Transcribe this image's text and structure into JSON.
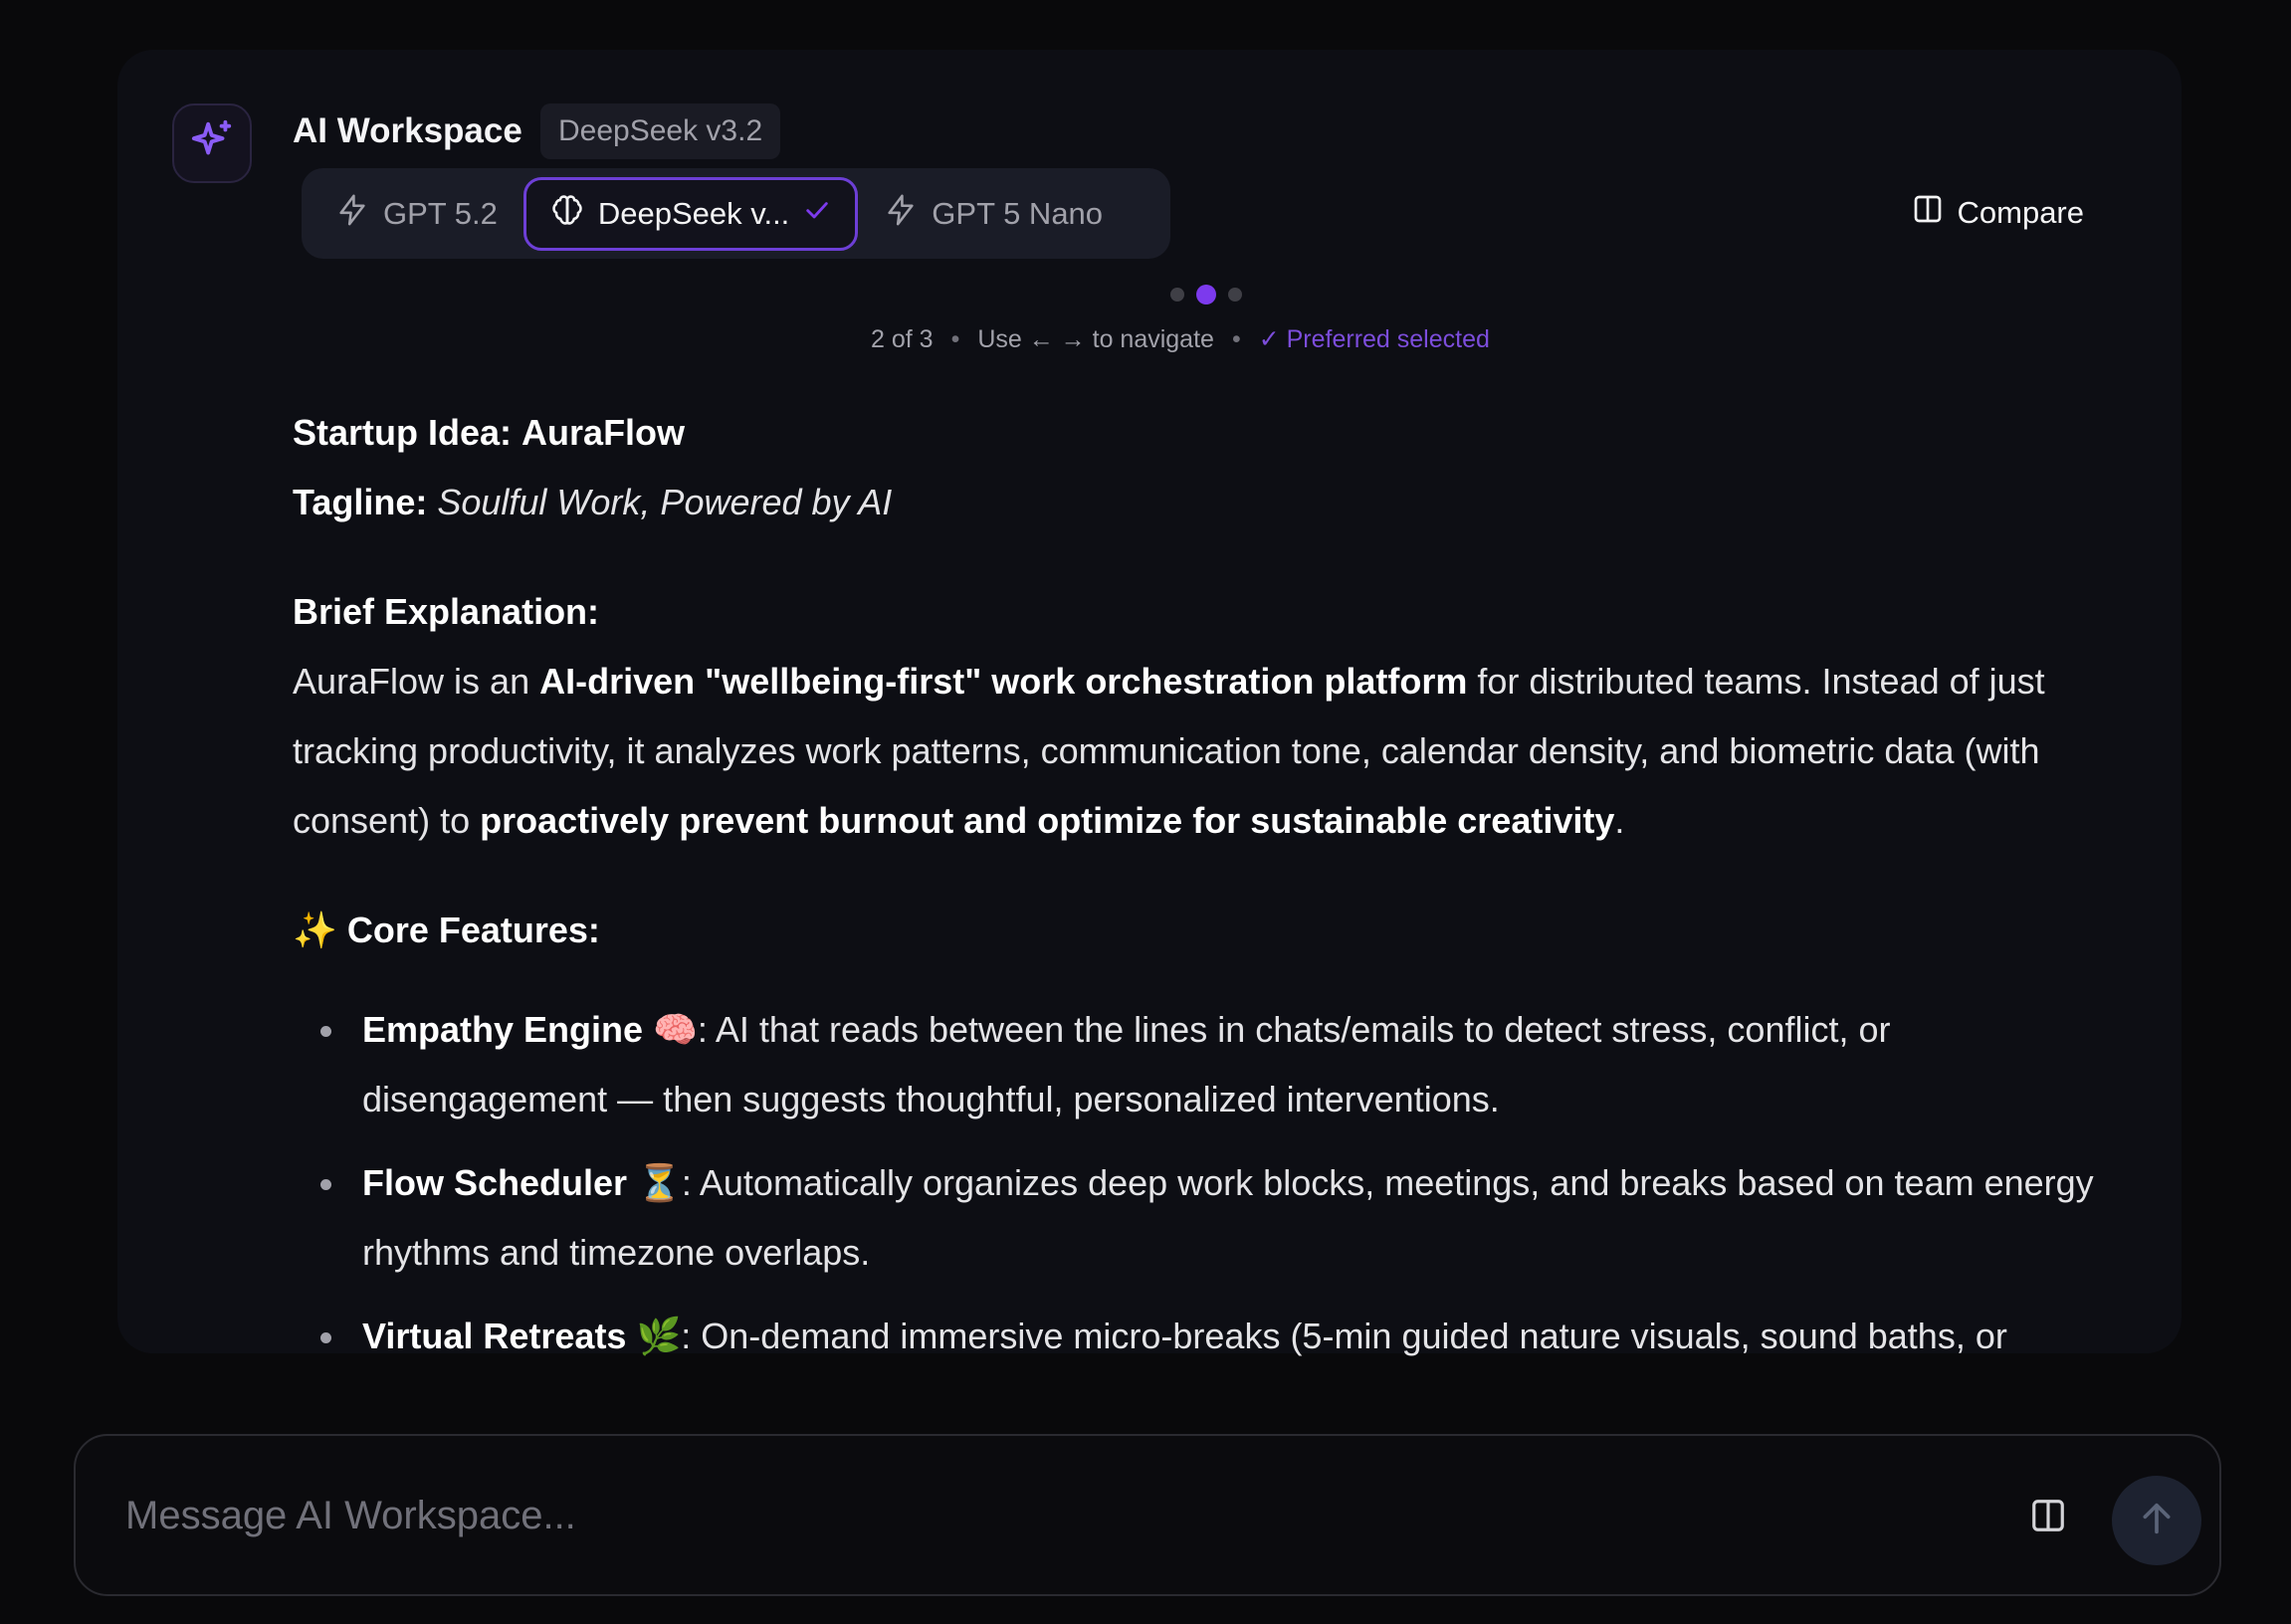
{
  "header": {
    "title": "AI Workspace",
    "model_badge": "DeepSeek v3.2",
    "compare_label": "Compare"
  },
  "model_tabs": [
    {
      "label": "GPT 5.2",
      "icon": "bolt-icon",
      "active": false
    },
    {
      "label": "DeepSeek v...",
      "icon": "brain-icon",
      "active": true
    },
    {
      "label": "GPT 5 Nano",
      "icon": "bolt-icon",
      "active": false
    }
  ],
  "pager": {
    "position": "2 of 3",
    "hint": "Use ← → to navigate",
    "preferred": "✓ Preferred selected",
    "total": 3,
    "current": 2
  },
  "response": {
    "title_label": "Startup Idea:",
    "title_value": "AuraFlow",
    "tagline_label": "Tagline:",
    "tagline_value": "Soulful Work, Powered by AI",
    "explanation_heading": "Brief Explanation:",
    "explanation": {
      "t1": "AuraFlow is an ",
      "b1": "AI-driven \"wellbeing-first\" work orchestration platform",
      "t2": " for distributed teams. Instead of just tracking productivity, it analyzes work patterns, communication tone, calendar density, and biometric data (with consent) to ",
      "b2": "proactively prevent burnout and optimize for sustainable creativity",
      "t3": "."
    },
    "features_heading": "✨ Core Features:",
    "features": [
      {
        "name": "Empathy Engine 🧠",
        "text": ": AI that reads between the lines in chats/emails to detect stress, conflict, or disengagement — then suggests thoughtful, personalized interventions."
      },
      {
        "name": "Flow Scheduler ⏳",
        "text": ": Automatically organizes deep work blocks, meetings, and breaks based on team energy rhythms and timezone overlaps."
      },
      {
        "name": "Virtual Retreats 🌿",
        "text": ": On-demand immersive micro-breaks (5-min guided nature visuals, sound baths, or"
      }
    ]
  },
  "composer": {
    "placeholder": "Message AI Workspace..."
  },
  "colors": {
    "accent": "#7c3aed",
    "background": "#09090b",
    "card": "#0d0e14"
  }
}
